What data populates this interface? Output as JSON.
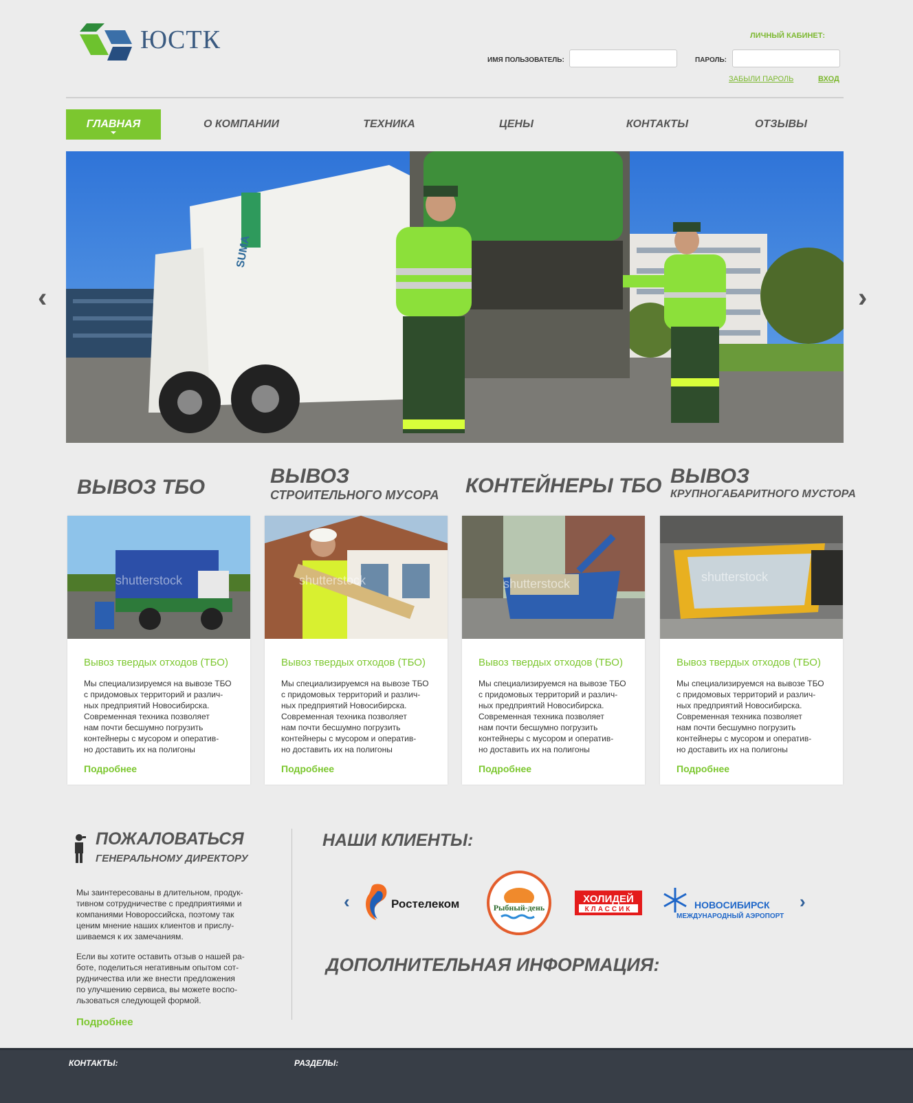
{
  "header": {
    "logo_text": "ЮСТК",
    "cabinet_title": "ЛИЧНЫЙ КАБИНЕТ:",
    "username_label": "ИМЯ ПОЛЬЗОВАТЕЛЬ:",
    "username_value": "",
    "password_label": "ПАРОЛЬ:",
    "password_value": "",
    "forgot_link": "ЗАБЫЛИ ПАРОЛЬ",
    "login_button": "ВХОД"
  },
  "nav": [
    {
      "label": "ГЛАВНАЯ",
      "active": true
    },
    {
      "label": "О КОМПАНИИ"
    },
    {
      "label": "ТЕХНИКА"
    },
    {
      "label": "ЦЕНЫ"
    },
    {
      "label": "КОНТАКТЫ"
    },
    {
      "label": "ОТЗЫВЫ"
    }
  ],
  "slider": {
    "prev_icon": "chevron-left-icon",
    "next_icon": "chevron-right-icon",
    "prev_glyph": "‹",
    "next_glyph": "›",
    "truck_brand": "SUMA"
  },
  "services": [
    {
      "title_big": "ВЫВОЗ ТБО",
      "title_small": "",
      "card_title": "Вывоз твердых отходов (ТБО)",
      "text": "Мы специализируемся на вывозе ТБО\nс придомовых территорий и различ-\nных предприятий Новосибирска.\nСовременная техника позволяет\nнам почти бесшумно погрузить\n контейнеры с мусором и оператив-\nно доставить их на полигоны",
      "more": "Подробнее",
      "watermark": "shutterstock"
    },
    {
      "title_big": "ВЫВОЗ",
      "title_small": "СТРОИТЕЛЬНОГО МУСОРА",
      "card_title": "Вывоз твердых отходов (ТБО)",
      "text": "Мы специализируемся на вывозе ТБО\nс придомовых территорий и различ-\nных предприятий Новосибирска.\nСовременная техника позволяет\nнам почти бесшумно погрузить\n контейнеры с мусором и оператив-\nно доставить их на полигоны",
      "more": "Подробнее",
      "watermark": "shutterstock"
    },
    {
      "title_big": "КОНТЕЙНЕРЫ ТБО",
      "title_small": "",
      "card_title": "Вывоз твердых отходов (ТБО)",
      "text": "Мы специализируемся на вывозе ТБО\nс придомовых территорий и различ-\nных предприятий Новосибирска.\nСовременная техника позволяет\nнам почти бесшумно погрузить\n контейнеры с мусором и оператив-\nно доставить их на полигоны",
      "more": "Подробнее",
      "watermark": "shutterstock"
    },
    {
      "title_big": "ВЫВОЗ",
      "title_small": "КРУПНОГАБАРИТНОГО МУСТОРА",
      "card_title": "Вывоз твердых отходов (ТБО)",
      "text": "Мы специализируемся на вывозе ТБО\nс придомовых территорий и различ-\nных предприятий Новосибирска.\nСовременная техника позволяет\nнам почти бесшумно погрузить\n контейнеры с мусором и оператив-\nно доставить их на полигоны",
      "more": "Подробнее",
      "watermark": "shutterstock"
    }
  ],
  "complaint": {
    "title1": "ПОЖАЛОВАТЬСЯ",
    "title2": "ГЕНЕРАЛЬНОМУ ДИРЕКТОРУ",
    "icon": "person-speaker-icon",
    "para1": "Мы заинтересованы в длительном, продук-\nтивном сотрудничестве с предприятиями и\nкомпаниями Новороссийска, поэтому так\nценим мнение наших клиентов и прислу-\nшиваемся к их замечаниям.",
    "para2": "Если вы хотите оставить отзыв о нашей ра-\nботе, поделиться негативным опытом сот-\nрудничества или же внести предложения\nпо улучшению сервиса, вы можете воспо-\nльзоваться следующей формой.",
    "more": "Подробнее"
  },
  "clients": {
    "title": "НАШИ КЛИЕНТЫ:",
    "prev_glyph": "‹",
    "next_glyph": "›",
    "logos": {
      "rostelecom": "Ростелеком",
      "rybny_den": "Рыбный-день",
      "holiday_1": "ХОЛИДЕЙ",
      "holiday_2": "КЛАССИК",
      "airport_1": "НОВОСИБИРСК",
      "airport_2": "МЕЖДУНАРОДНЫЙ АЭРОПОРТ"
    }
  },
  "extra": {
    "title": "ДОПОЛНИТЕЛЬНАЯ ИНФОРМАЦИЯ:"
  },
  "footer": {
    "contacts": "КОНТАКТЫ:",
    "sections": "РАЗДЕЛЫ:"
  },
  "colors": {
    "accent": "#7cc72f",
    "text": "#555555",
    "footer": "#383e47",
    "brand_blue": "#3a5a80"
  }
}
